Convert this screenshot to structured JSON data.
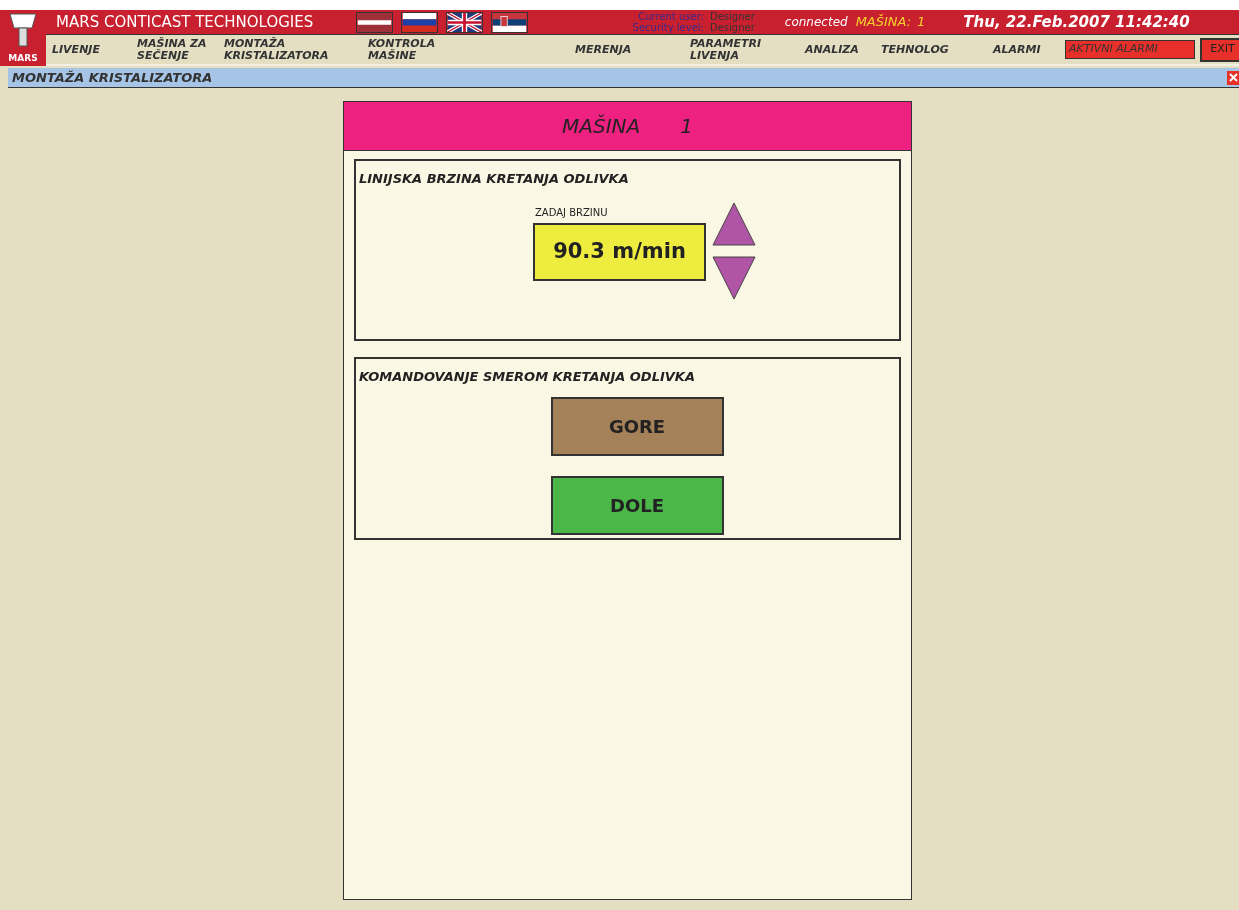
{
  "header": {
    "brand": "MARS CONTICAST TECHNOLOGIES",
    "logo_text": "MARS",
    "user_label": "Current user:",
    "user": "Designer",
    "level_label": "Security level:",
    "level_value": "Designer",
    "connection": "connected",
    "machine_label": "MAŠINA:",
    "machine": "1",
    "datetime": "Thu, 22.Feb.2007 11:42:40"
  },
  "menu": [
    {
      "lines": [
        "LIVENJE"
      ]
    },
    {
      "lines": [
        "MAŠINA ZA",
        "SEČENJE"
      ]
    },
    {
      "lines": [
        "MONTAŽA",
        "KRISTALIZATORA"
      ]
    },
    {
      "lines": [
        "KONTROLA",
        "MAŠINE"
      ]
    },
    {
      "lines": [
        "MERENJA"
      ]
    },
    {
      "lines": [
        "PARAMETRI",
        "LIVENJA"
      ]
    },
    {
      "lines": [
        "ANALIZA"
      ]
    },
    {
      "lines": [
        "TEHNOLOG"
      ]
    },
    {
      "lines": [
        "ALARMI"
      ]
    }
  ],
  "alarm_button": "AKTIVNI ALARMI",
  "exit_button": "EXIT",
  "page_title": "MONTAŽA KRISTALIZATORA",
  "panel": {
    "title": "MAŠINA",
    "number": "1",
    "speed": {
      "title": "LINIJSKA BRZINA KRETANJA ODLIVKA",
      "label": "ZADAJ BRZINU",
      "value": "90.3 m/min"
    },
    "direction": {
      "title": "KOMANDOVANJE SMEROM KRETANJA ODLIVKA",
      "buttons": [
        {
          "label": "GORE",
          "color": "#a5815a"
        },
        {
          "label": "DOLE",
          "color": "#4ab748"
        }
      ]
    }
  }
}
